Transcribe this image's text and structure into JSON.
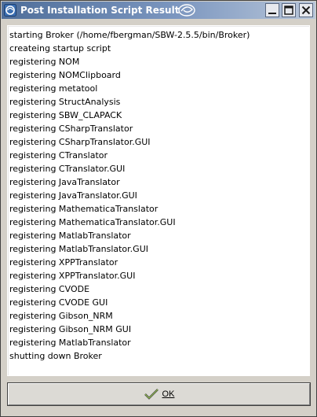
{
  "window": {
    "title": "Post Installation Script Result",
    "controls": [
      "minimize-icon",
      "maximize-icon",
      "close-icon"
    ]
  },
  "log": {
    "lines": [
      "starting Broker (/home/fbergman/SBW-2.5.5/bin/Broker)",
      "createing startup script",
      "registering NOM",
      "registering NOMClipboard",
      "registering metatool",
      "registering StructAnalysis",
      "registering SBW_CLAPACK",
      "registering CSharpTranslator",
      "registering CSharpTranslator.GUI",
      "registering CTranslator",
      "registering CTranslator.GUI",
      "registering JavaTranslator",
      "registering JavaTranslator.GUI",
      "registering MathematicaTranslator",
      "registering MathematicaTranslator.GUI",
      "registering MatlabTranslator",
      "registering MatlabTranslator.GUI",
      "registering XPPTranslator",
      "registering XPPTranslator.GUI",
      "registering CVODE",
      "registering CVODE GUI",
      "registering Gibson_NRM",
      "registering Gibson_NRM GUI",
      "registering MatlabTranslator",
      "shutting down Broker"
    ]
  },
  "actions": {
    "ok_label": "OK",
    "ok_icon": "checkmark-icon"
  },
  "colors": {
    "titlebar_start": "#4f6e9a",
    "titlebar_end": "#b9c7da",
    "window_bg": "#d4d0c8",
    "log_bg": "#ffffff"
  }
}
